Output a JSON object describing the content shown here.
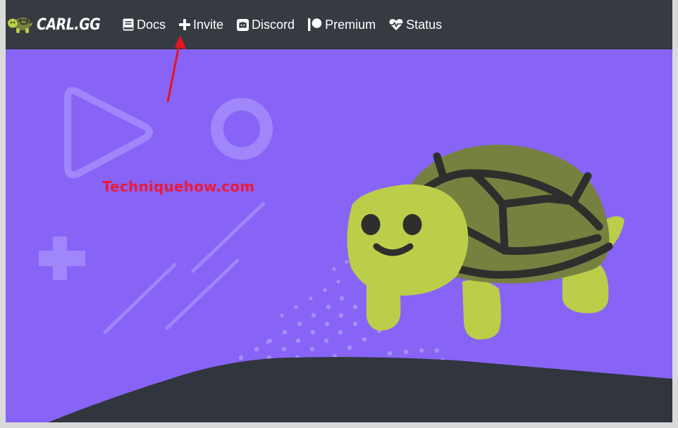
{
  "brand": {
    "name": "CARL.GG",
    "logo_icon": "turtle-icon"
  },
  "nav": {
    "items": [
      {
        "label": "Docs",
        "icon": "book-icon"
      },
      {
        "label": "Invite",
        "icon": "plus-icon"
      },
      {
        "label": "Discord",
        "icon": "discord-icon"
      },
      {
        "label": "Premium",
        "icon": "patreon-icon"
      },
      {
        "label": "Status",
        "icon": "heartbeat-icon"
      }
    ]
  },
  "hero": {
    "mascot": "turtle-illustration",
    "decorations": [
      "play-triangle-shape",
      "ring-shape",
      "plus-shape",
      "diagonal-lines",
      "dot-trail"
    ]
  },
  "annotation": {
    "watermark_text": "Techniquehow.com",
    "arrow": "red-arrow-pointing-to-invite"
  },
  "colors": {
    "navbar": "#363b42",
    "hero_background": "#8764f6",
    "ground": "#31353d",
    "turtle_skin": "#bccd49",
    "turtle_shell": "#768140",
    "shell_lines": "#2e2f2c",
    "watermark": "#ec1a3a"
  }
}
